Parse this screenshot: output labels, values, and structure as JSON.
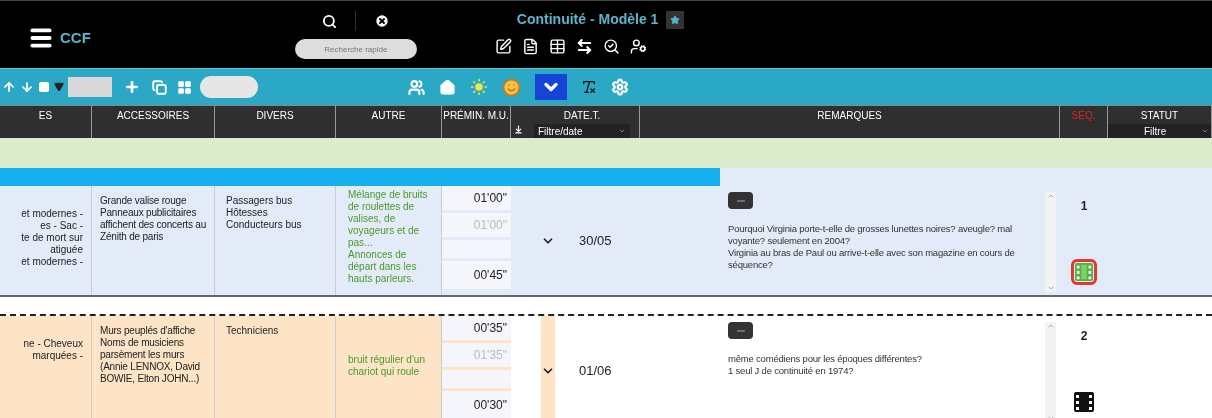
{
  "app": {
    "title": "CCF"
  },
  "search": {
    "placeholder": "Recherche rapide"
  },
  "document": {
    "title": "Continuité - Modèle 1"
  },
  "toolbar": {
    "dropdown_on": true
  },
  "columns": [
    {
      "label": "ES",
      "highlighted": false
    },
    {
      "label": "ACCESSOIRES",
      "highlighted": false
    },
    {
      "label": "DIVERS",
      "highlighted": false
    },
    {
      "label": "AUTRE",
      "highlighted": false
    },
    {
      "label": "PRÉMIN. M.U.",
      "highlighted": false
    },
    {
      "label": "DATE.T.",
      "highlighted": false,
      "filter": "Filtre/date"
    },
    {
      "label": "REMARQUES",
      "highlighted": false
    },
    {
      "label": "SÉQ.",
      "highlighted": true
    },
    {
      "label": "STATUT",
      "highlighted": false,
      "filter": "Filtre"
    }
  ],
  "rows": [
    {
      "selected": true,
      "col_1": [
        "et modernes -",
        "es - Sac -",
        "te de mort sur",
        "atiguée",
        "et modernes -"
      ],
      "accessoires": "Grande valise rouge\nPanneaux publicitaires affichent des concerts au Zénith de paris",
      "divers": "Passagers bus\nHôtesses\nConducteurs bus",
      "autre": "Mélange de bruits de roulettes de valises, de voyageurs et de pas...\nAnnonces de départ dans les hauts parleurs.",
      "time_start": "01'00\"",
      "time_planned": "01'00\"",
      "time_end": "00'45\"",
      "date": "30/05",
      "remarques": "Pourquoi Virginia porte-t-elle de grosses lunettes noires? aveugle? mal voyante? seulement en 2004?\nVirginia au bras de Paul ou arrive-t-elle avec son magazine en cours de séquence?",
      "seq": "1"
    },
    {
      "selected": false,
      "col_1": [
        "ne - Cheveux",
        "marquées -"
      ],
      "accessoires": "Murs peuplés d'affiche\nNoms de musiciens parsèment les murs (Annie LENNOX, David BOWIE, Elton JOHN...)",
      "divers": "Techniciens",
      "autre": "bruit régulier d'un chariot qui roule",
      "time_start": "00'35\"",
      "time_planned": "01'35\"",
      "time_end": "00'30\"",
      "date": "01/06",
      "remarques": "même comédiens pour les époques différentes?\n1 seul J de continuité en 1974?",
      "seq": "2"
    }
  ]
}
